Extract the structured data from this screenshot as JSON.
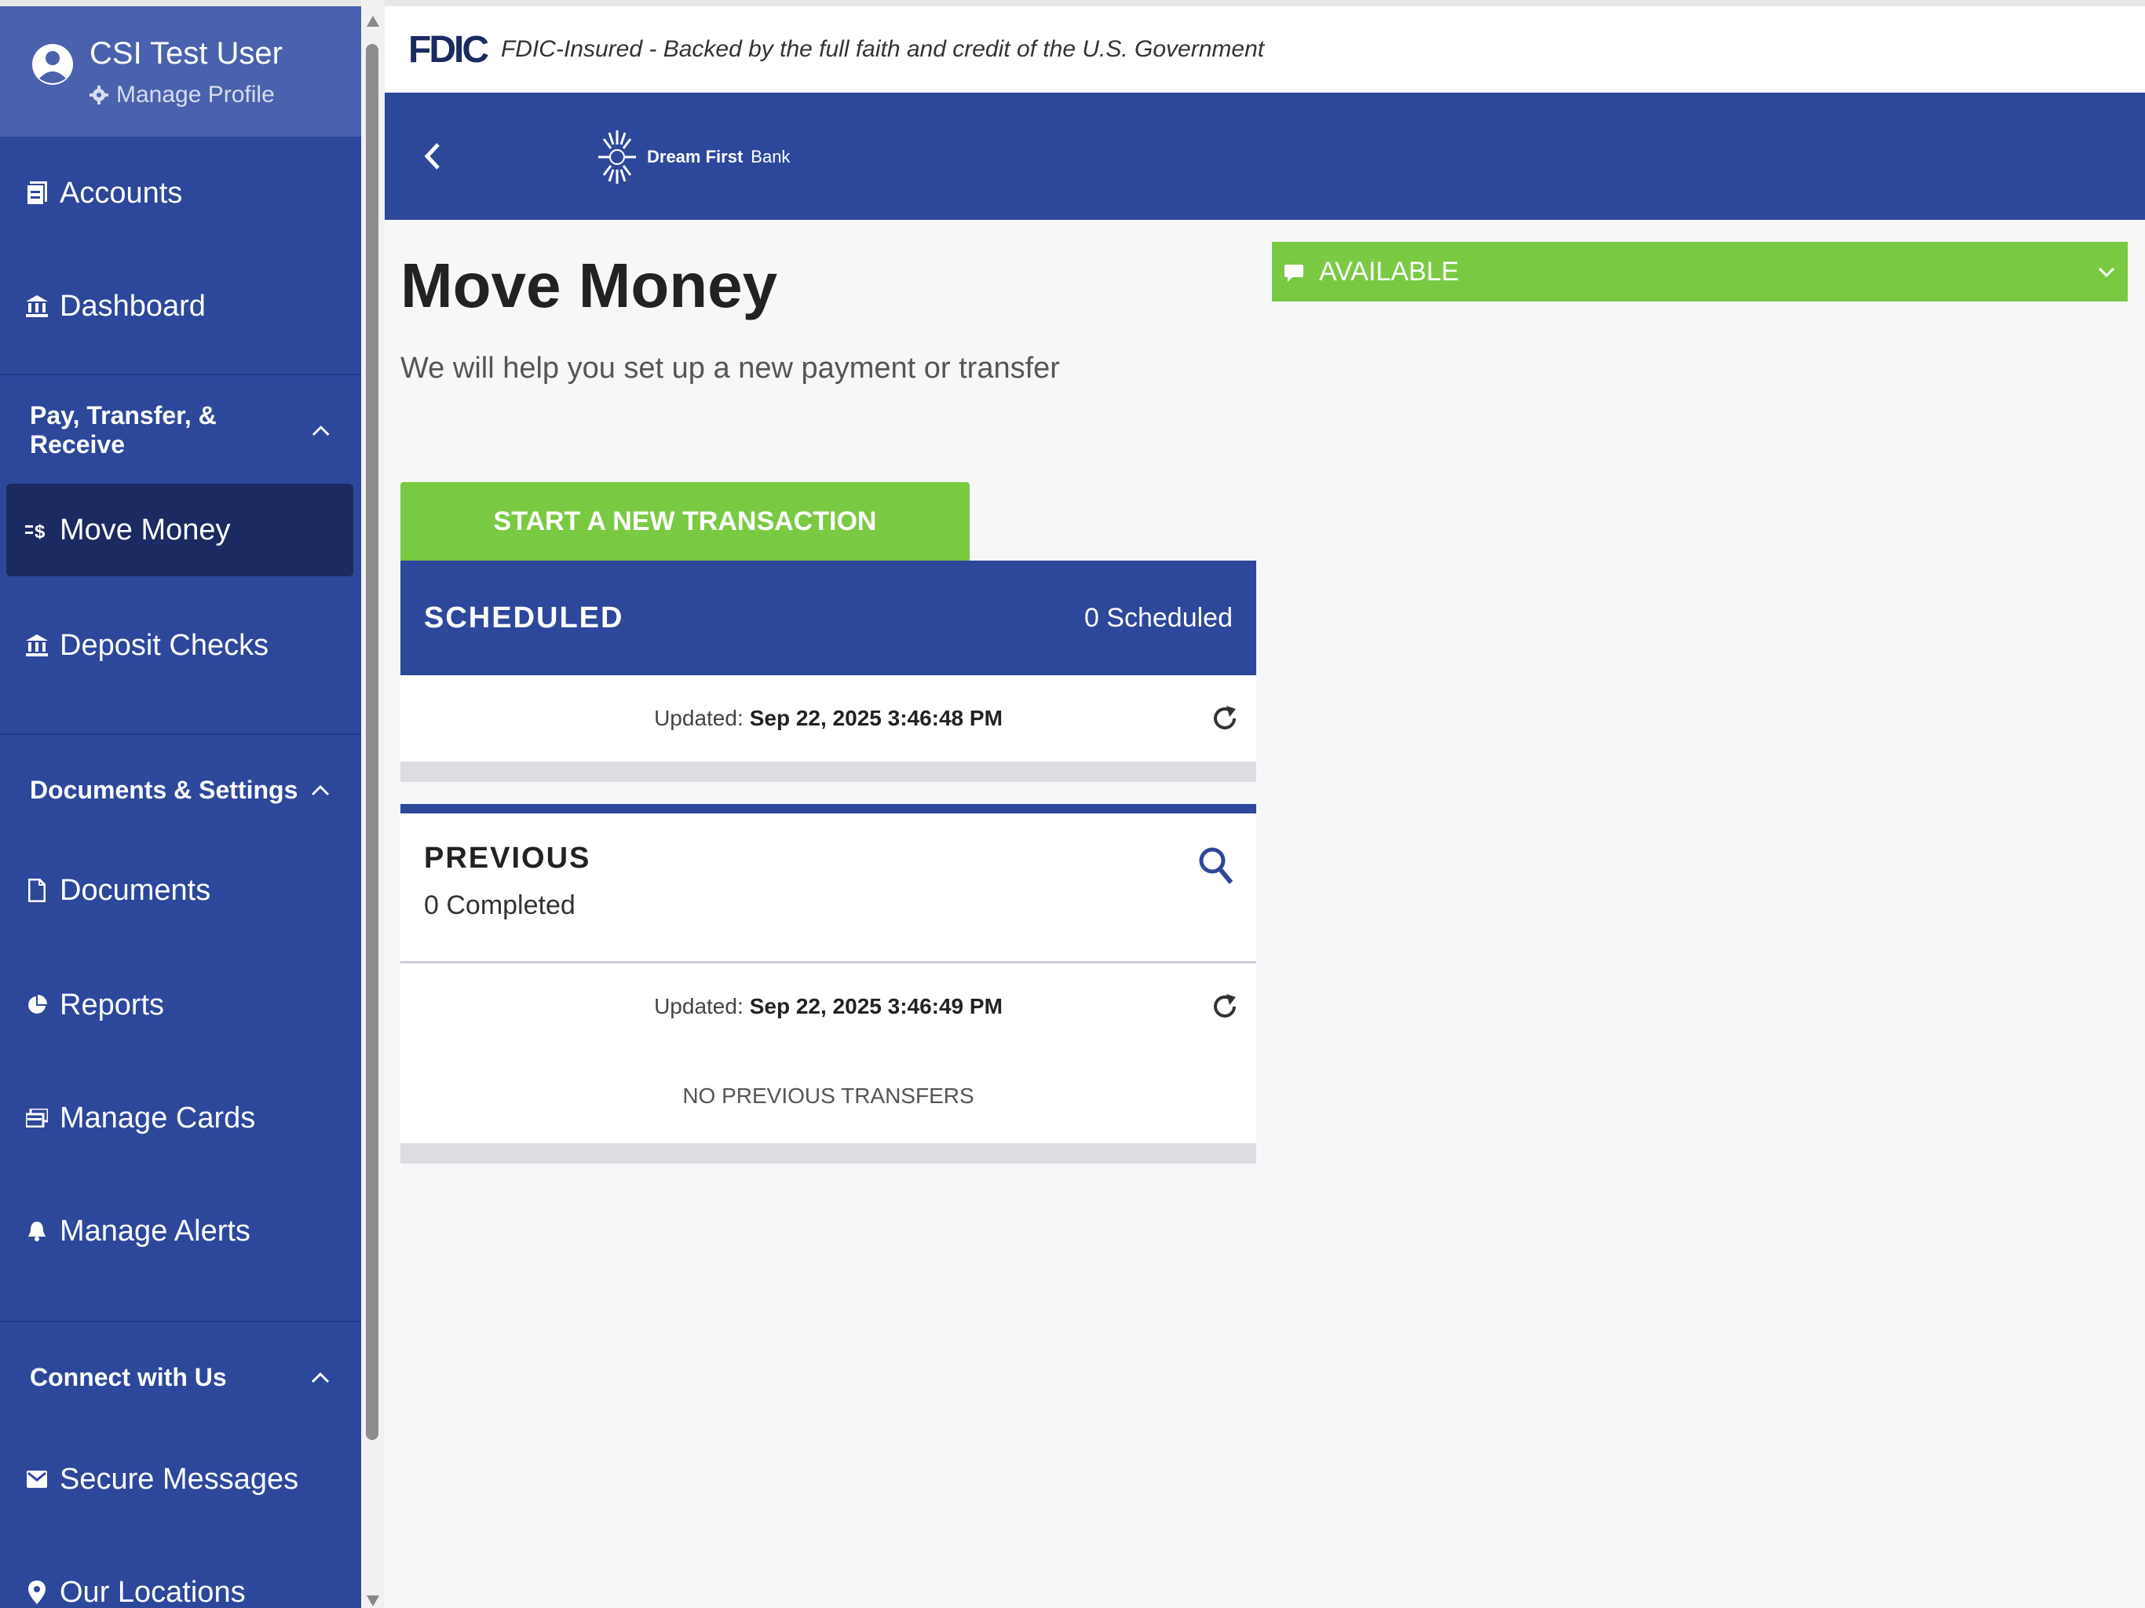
{
  "sidebar": {
    "user_name": "CSI Test User",
    "manage_profile": "Manage Profile",
    "items": {
      "accounts": "Accounts",
      "dashboard": "Dashboard",
      "move_money": "Move Money",
      "deposit_checks": "Deposit Checks",
      "documents": "Documents",
      "reports": "Reports",
      "manage_cards": "Manage Cards",
      "manage_alerts": "Manage Alerts",
      "secure_messages": "Secure Messages",
      "our_locations": "Our Locations"
    },
    "sections": {
      "pay_transfer": "Pay, Transfer, & Receive",
      "documents_settings": "Documents & Settings",
      "connect": "Connect with Us"
    }
  },
  "fdic": {
    "logo": "FDIC",
    "text": "FDIC-Insured - Backed by the full faith and credit of the U.S. Government"
  },
  "bank": {
    "name": "Dream First",
    "suffix": "Bank"
  },
  "main": {
    "title": "Move Money",
    "subtitle": "We will help you set up a new payment or transfer",
    "start_button": "START A NEW TRANSACTION",
    "scheduled": {
      "title": "SCHEDULED",
      "count": "0 Scheduled",
      "updated_label": "Updated:",
      "updated_time": "Sep 22, 2025 3:46:48 PM"
    },
    "previous": {
      "title": "PREVIOUS",
      "count": "0 Completed",
      "updated_label": "Updated:",
      "updated_time": "Sep 22, 2025 3:46:49 PM",
      "empty_text": "NO PREVIOUS TRANSFERS"
    },
    "available": "AVAILABLE"
  },
  "colors": {
    "brand_blue": "#2d479b",
    "active_nav": "#1b2a60",
    "accent_green": "#7ac943"
  }
}
